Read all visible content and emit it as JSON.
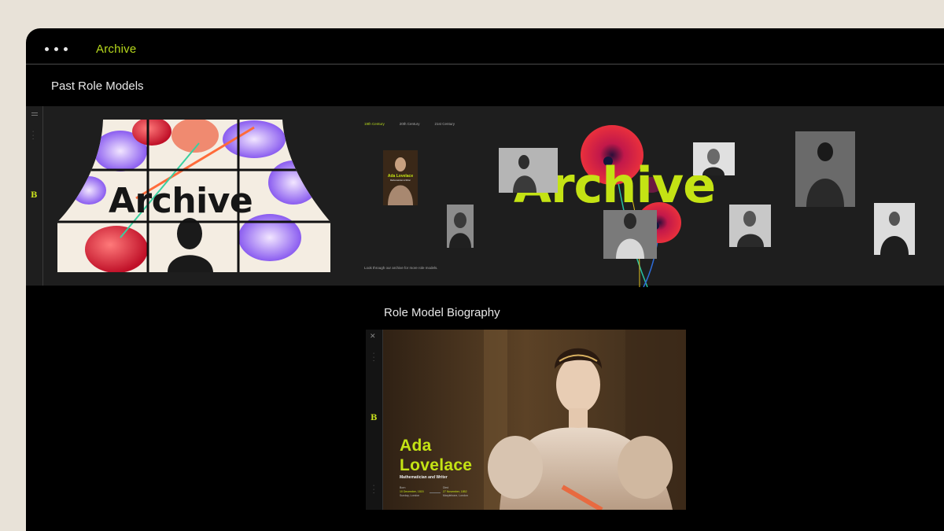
{
  "window": {
    "title": "Archive"
  },
  "sections": {
    "past_role_models": "Past Role Models",
    "biography": "Role Model Biography"
  },
  "archive_screen": {
    "hero_word": "Archive",
    "big_word": "Archive",
    "tabs": [
      "19th Century",
      "20th Century",
      "21st Century"
    ],
    "active_tab": "19th Century",
    "caption": "Look through our archive for more role models.",
    "featured_card": {
      "name": "Ada Lovelace",
      "role": "Mathematician & Writer"
    },
    "rail": {
      "logo": "B"
    },
    "colors": {
      "accent": "#c4e314",
      "panel": "#1e1e1e"
    }
  },
  "biography_screen": {
    "name_line1": "Ada",
    "name_line2": "Lovelace",
    "role": "Mathematician and Writer",
    "born_label": "Born",
    "born_date": "10 December, 1815",
    "born_place": "Sunday, London",
    "died_label": "Died",
    "died_date": "27 November, 1852",
    "died_place": "Marylebone, London",
    "rail": {
      "close_icon": "close-icon",
      "logo": "B"
    }
  }
}
